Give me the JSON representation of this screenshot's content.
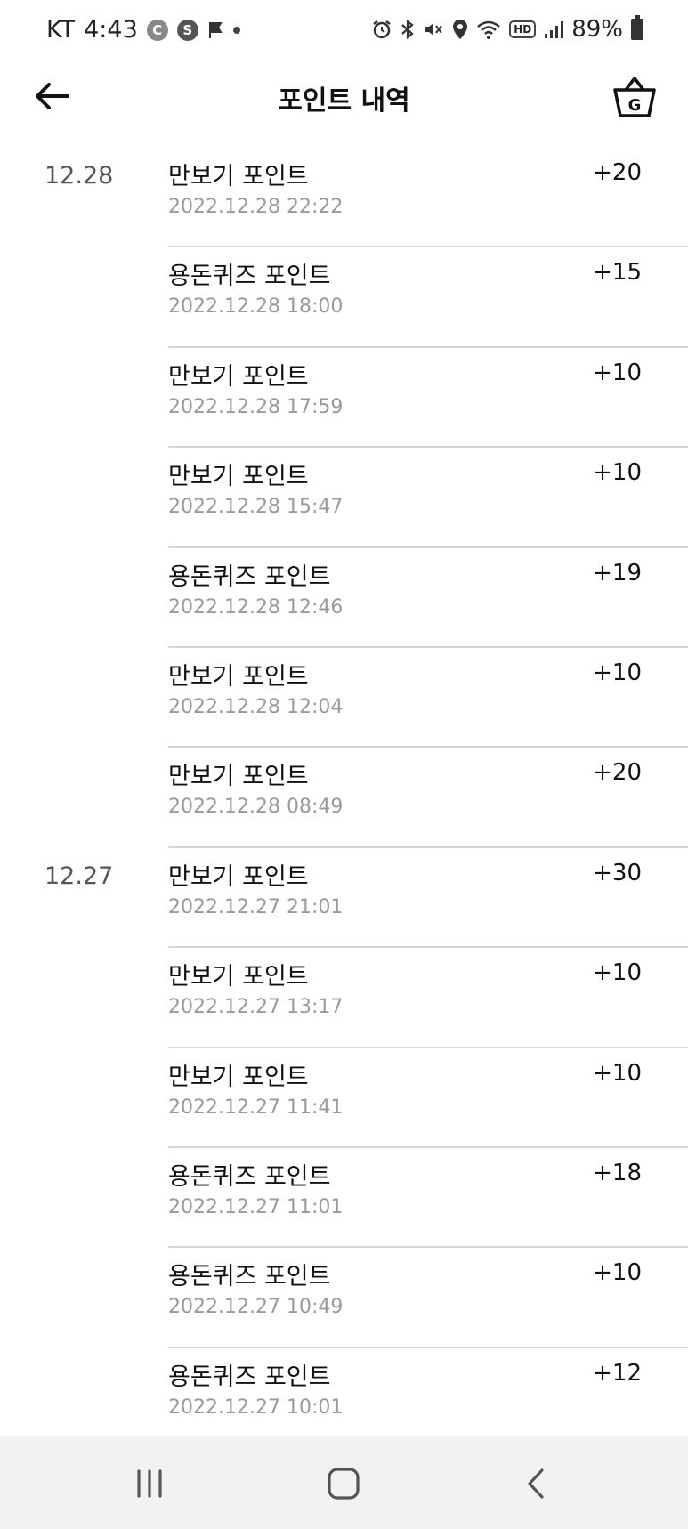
{
  "status_bar": {
    "carrier": "KT",
    "time": "4:43",
    "battery": "89%",
    "hd": "HD",
    "icons": [
      "c-circle-icon",
      "s-circle-icon",
      "flag-icon",
      "dot-icon",
      "alarm-icon",
      "bluetooth-icon",
      "mute-icon",
      "location-icon",
      "wifi-icon",
      "hd-icon",
      "signal-icon",
      "battery-icon"
    ]
  },
  "header": {
    "title": "포인트 내역",
    "shop_letter": "G"
  },
  "history": [
    {
      "date": "12.28",
      "title": "만보기 포인트",
      "timestamp": "2022.12.28 22:22",
      "points": "+20"
    },
    {
      "date": "",
      "title": "용돈퀴즈 포인트",
      "timestamp": "2022.12.28 18:00",
      "points": "+15"
    },
    {
      "date": "",
      "title": "만보기 포인트",
      "timestamp": "2022.12.28 17:59",
      "points": "+10"
    },
    {
      "date": "",
      "title": "만보기 포인트",
      "timestamp": "2022.12.28 15:47",
      "points": "+10"
    },
    {
      "date": "",
      "title": "용돈퀴즈 포인트",
      "timestamp": "2022.12.28 12:46",
      "points": "+19"
    },
    {
      "date": "",
      "title": "만보기 포인트",
      "timestamp": "2022.12.28 12:04",
      "points": "+10"
    },
    {
      "date": "",
      "title": "만보기 포인트",
      "timestamp": "2022.12.28 08:49",
      "points": "+20"
    },
    {
      "date": "12.27",
      "title": "만보기 포인트",
      "timestamp": "2022.12.27 21:01",
      "points": "+30"
    },
    {
      "date": "",
      "title": "만보기 포인트",
      "timestamp": "2022.12.27 13:17",
      "points": "+10"
    },
    {
      "date": "",
      "title": "만보기 포인트",
      "timestamp": "2022.12.27 11:41",
      "points": "+10"
    },
    {
      "date": "",
      "title": "용돈퀴즈 포인트",
      "timestamp": "2022.12.27 11:01",
      "points": "+18"
    },
    {
      "date": "",
      "title": "용돈퀴즈 포인트",
      "timestamp": "2022.12.27 10:49",
      "points": "+10"
    },
    {
      "date": "",
      "title": "용돈퀴즈 포인트",
      "timestamp": "2022.12.27 10:01",
      "points": "+12"
    }
  ]
}
